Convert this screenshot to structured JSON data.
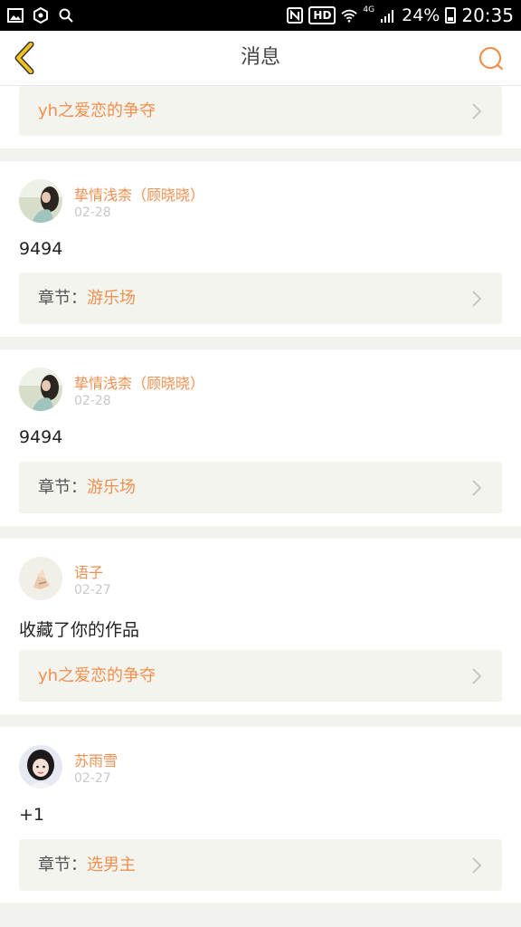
{
  "status_bar": {
    "hd": "HD",
    "network": "4G",
    "battery": "24%",
    "time": "20:35"
  },
  "header": {
    "title": "消息"
  },
  "top_link": {
    "title": "yh之爱恋的争夺"
  },
  "messages": [
    {
      "user": "挚情浅柰（顾晓晓）",
      "date": "02-28",
      "content": "9494",
      "link_label": "章节：",
      "link_title": "游乐场"
    },
    {
      "user": "挚情浅柰（顾晓晓）",
      "date": "02-28",
      "content": "9494",
      "link_label": "章节：",
      "link_title": "游乐场"
    },
    {
      "user": "语子",
      "date": "02-27",
      "content": "收藏了你的作品",
      "link_label": "",
      "link_title": "yh之爱恋的争夺"
    },
    {
      "user": "苏雨雪",
      "date": "02-27",
      "content": "+1",
      "link_label": "章节：",
      "link_title": "选男主"
    }
  ],
  "colors": {
    "accent": "#f08f4f",
    "back_arrow": "#f2c21f",
    "background": "#f2f2ee"
  }
}
